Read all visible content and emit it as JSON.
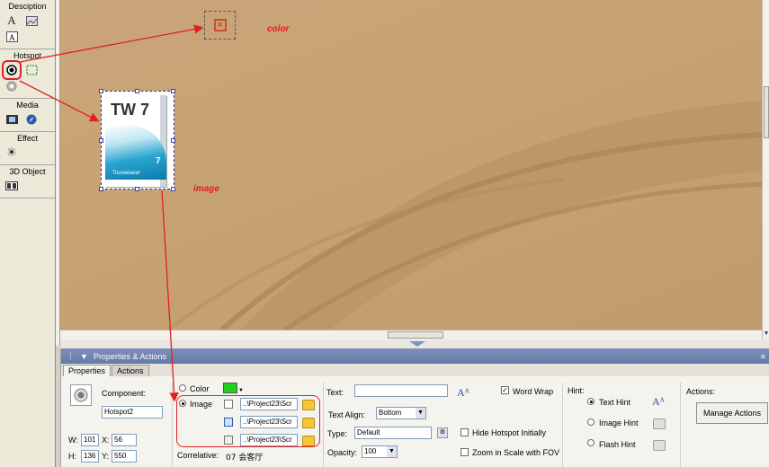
{
  "toolbox": {
    "description": {
      "title": "Desciption",
      "icons": [
        "text-icon",
        "image-icon",
        "text-box-icon"
      ]
    },
    "hotspot": {
      "title": "Hotspot",
      "icons": [
        "point-hotspot-icon",
        "rect-hotspot-icon",
        "rotate-icon"
      ]
    },
    "media": {
      "title": "Media",
      "icons": [
        "film-icon",
        "compass-icon"
      ]
    },
    "effect": {
      "title": "Effect",
      "icons": [
        "sun-icon"
      ]
    },
    "object3d": {
      "title": "3D Object",
      "icons": [
        "3d-object-icon"
      ]
    }
  },
  "canvas": {
    "annot_color": "color",
    "annot_image": "image",
    "hotspot_image_title": "TW 7",
    "hotspot_image_sub": "Tourweaver",
    "hotspot_image_num": "7"
  },
  "panel": {
    "title": "Properties & Actions",
    "tabs": [
      "Properties",
      "Actions"
    ],
    "component_label": "Component:",
    "component_value": "Hotspot2",
    "w_label": "W:",
    "w_value": "101",
    "x_label": "X:",
    "x_value": "56",
    "h_label": "H:",
    "h_value": "136",
    "y_label": "Y:",
    "y_value": "550",
    "color_label": "Color",
    "image_label": "Image",
    "paths": [
      "..\\Project23\\Scr",
      "..\\Project23\\Scr",
      "..\\Project23\\Scr"
    ],
    "correlative_label": "Correlative:",
    "correlative_value": "07 会客厅",
    "text_label": "Text:",
    "text_value": "",
    "word_wrap_label": "Word Wrap",
    "text_align_label": "Text Align:",
    "text_align_value": "Bottom",
    "type_label": "Type:",
    "type_value": "Default",
    "hide_label": "Hide Hotspot Initially",
    "opacity_label": "Opacity:",
    "opacity_value": "100",
    "zoom_label": "Zoom in Scale with FOV",
    "hint_label": "Hint:",
    "hint_options": [
      "Text Hint",
      "Image Hint",
      "Flash Hint"
    ],
    "actions_label": "Actions:",
    "manage_actions": "Manage Actions"
  },
  "colors": {
    "canvas_bg": "#c7a273",
    "annotation": "#e02020",
    "titlebar": "#647aa8",
    "swatch": "#22d01e"
  }
}
